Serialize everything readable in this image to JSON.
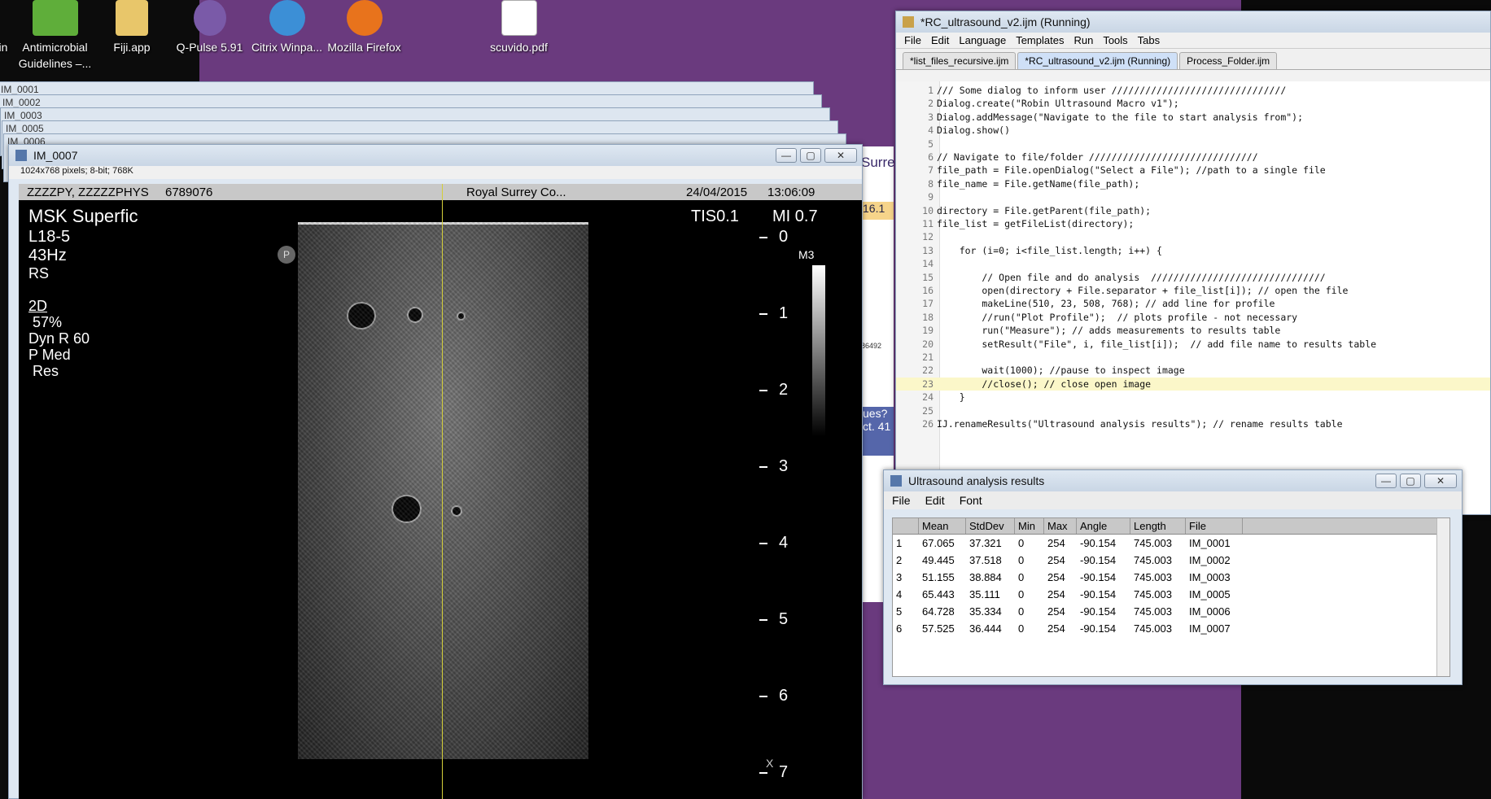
{
  "desktop": {
    "icons": [
      {
        "label": "Antimicrobial Guidelines –...",
        "icon": "adult-guidelines-icon",
        "color": "#5fae3a"
      },
      {
        "label": "Fiji.app",
        "icon": "folder-icon",
        "color": "#e8c66a"
      },
      {
        "label": "Q-Pulse 5.91",
        "icon": "qpulse-icon",
        "color": "#7a5aa8"
      },
      {
        "label": "Citrix Winpa...",
        "icon": "ie-icon",
        "color": "#3c8fd6"
      },
      {
        "label": "Mozilla Firefox",
        "icon": "firefox-icon",
        "color": "#e8731c"
      },
      {
        "label": "scuvido.pdf",
        "icon": "pdf-icon",
        "color": "#ffffff"
      }
    ],
    "left_fragment": "in"
  },
  "stacked_windows": [
    "IM_0001",
    "IM_0002",
    "IM_0003",
    "IM_0005",
    "IM_0006"
  ],
  "image_window": {
    "title": "IM_0007",
    "info": "1024x768 pixels; 8-bit; 768K",
    "header": {
      "patient": "ZZZZPY, ZZZZZPHYS",
      "id": "6789076",
      "hospital": "Royal Surrey Co...",
      "date": "24/04/2015",
      "time": "13:06:09"
    },
    "left_text": [
      "MSK Superfic",
      "L18-5",
      "43Hz",
      "RS",
      "2D",
      " 57%",
      "Dyn R 60",
      "P Med",
      " Res"
    ],
    "tis": "TIS0.1",
    "mi": "MI 0.7",
    "probe_badge": "P",
    "map": "M3",
    "depth_scale": [
      "0",
      "1",
      "2",
      "3",
      "4",
      "5",
      "6",
      "7"
    ],
    "x_marker": "X"
  },
  "editor": {
    "title": "*RC_ultrasound_v2.ijm (Running)",
    "menu": [
      "File",
      "Edit",
      "Language",
      "Templates",
      "Run",
      "Tools",
      "Tabs"
    ],
    "tabs": [
      "*list_files_recursive.ijm",
      "*RC_ultrasound_v2.ijm (Running)",
      "Process_Folder.ijm"
    ],
    "lines": [
      "/// Some dialog to inform user ///////////////////////////////",
      "Dialog.create(\"Robin Ultrasound Macro v1\");",
      "Dialog.addMessage(\"Navigate to the file to start analysis from\");",
      "Dialog.show()",
      "",
      "// Navigate to file/folder //////////////////////////////",
      "file_path = File.openDialog(\"Select a File\"); //path to a single file",
      "file_name = File.getName(file_path);",
      "",
      "directory = File.getParent(file_path);",
      "file_list = getFileList(directory);",
      "",
      "    for (i=0; i<file_list.length; i++) {",
      "",
      "        // Open file and do analysis  ///////////////////////////////",
      "        open(directory + File.separator + file_list[i]); // open the file",
      "        makeLine(510, 23, 508, 768); // add line for profile",
      "        //run(\"Plot Profile\");  // plots profile - not necessary",
      "        run(\"Measure\"); // adds measurements to results table",
      "        setResult(\"File\", i, file_list[i]);  // add file name to results table",
      "",
      "        wait(1000); //pause to inspect image",
      "        //close(); // close open image",
      "    }",
      "",
      "IJ.renameResults(\"Ultrasound analysis results\"); // rename results table"
    ]
  },
  "results": {
    "title": "Ultrasound analysis results",
    "menu": [
      "File",
      "Edit",
      "Font"
    ],
    "columns": [
      "",
      "Mean",
      "StdDev",
      "Min",
      "Max",
      "Angle",
      "Length",
      "File"
    ],
    "rows": [
      [
        "1",
        "67.065",
        "37.321",
        "0",
        "254",
        "-90.154",
        "745.003",
        "IM_0001"
      ],
      [
        "2",
        "49.445",
        "37.518",
        "0",
        "254",
        "-90.154",
        "745.003",
        "IM_0002"
      ],
      [
        "3",
        "51.155",
        "38.884",
        "0",
        "254",
        "-90.154",
        "745.003",
        "IM_0003"
      ],
      [
        "4",
        "65.443",
        "35.111",
        "0",
        "254",
        "-90.154",
        "745.003",
        "IM_0005"
      ],
      [
        "5",
        "64.728",
        "35.334",
        "0",
        "254",
        "-90.154",
        "745.003",
        "IM_0006"
      ],
      [
        "6",
        "57.525",
        "36.444",
        "0",
        "254",
        "-90.154",
        "745.003",
        "IM_0007"
      ]
    ]
  },
  "background_doc": {
    "snippets": [
      "Surre",
      "16.1",
      "ues?",
      "ct. 41",
      "86492"
    ]
  }
}
